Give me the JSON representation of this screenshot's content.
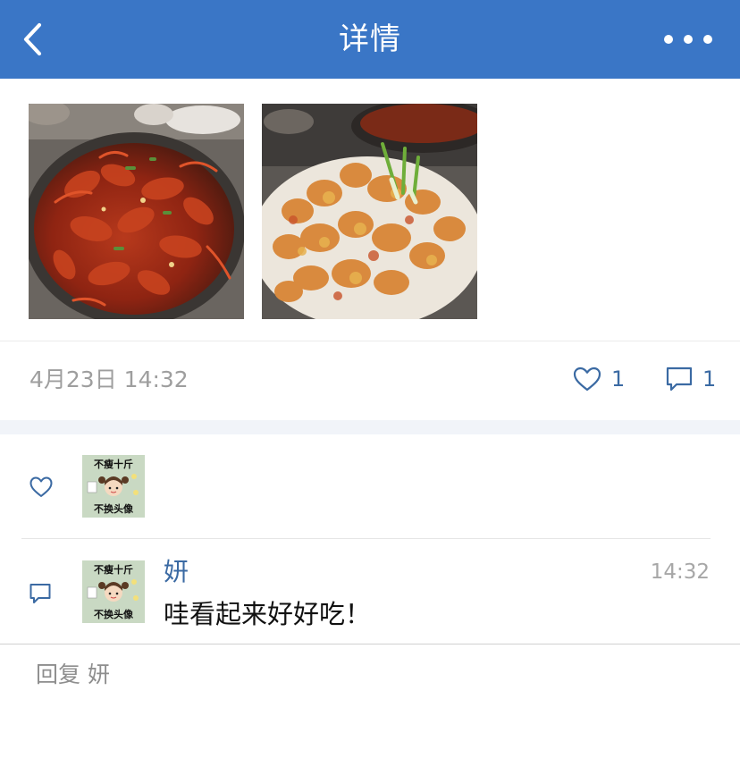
{
  "header": {
    "title": "详情",
    "back_icon": "chevron-left-icon",
    "more_icon": "more-horizontal-icon",
    "background_color": "#3a76c6"
  },
  "post": {
    "photos": [
      {
        "name": "crayfish-spicy-photo"
      },
      {
        "name": "crayfish-fried-photo"
      }
    ],
    "timestamp": "4月23日 14:32",
    "like_count": "1",
    "comment_count": "1"
  },
  "likes": {
    "icon": "heart-outline-icon",
    "avatar_text_top": "不瘦十斤",
    "avatar_text_bottom": "不换头像"
  },
  "comments": [
    {
      "user": "妍",
      "time": "14:32",
      "text": "哇看起来好好吃！",
      "avatar_text_top": "不瘦十斤",
      "avatar_text_bottom": "不换头像"
    }
  ],
  "reply": {
    "placeholder": "回复 妍"
  },
  "colors": {
    "accent": "#3b6aa3",
    "muted": "#9e9e9e"
  }
}
